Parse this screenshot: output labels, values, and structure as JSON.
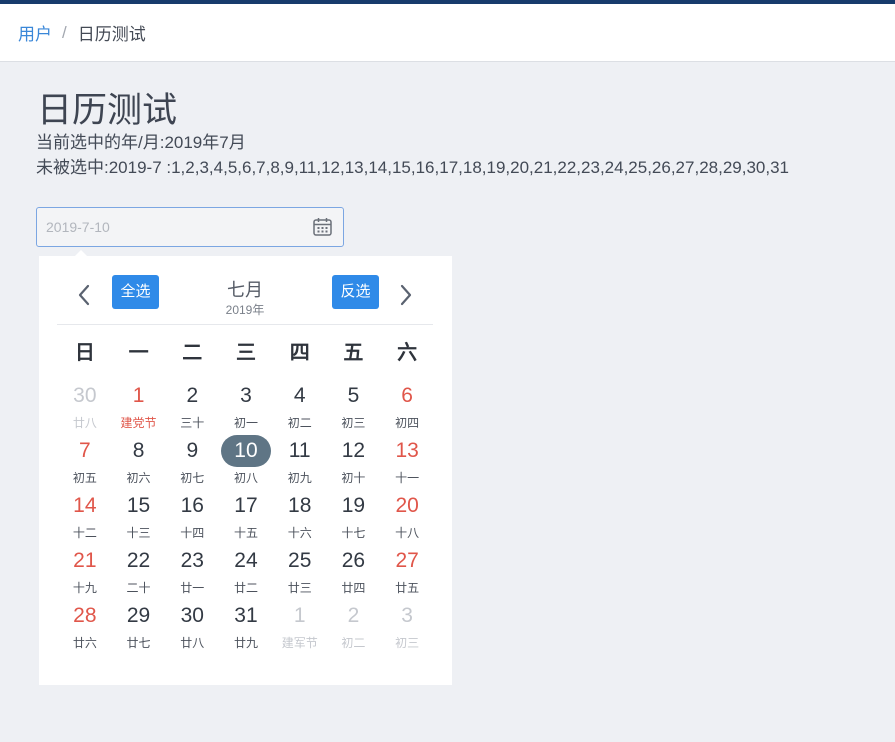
{
  "colors": {
    "top_bar": "#173b6c",
    "page_bg": "#eef0f4",
    "link": "#3a87d8",
    "accent": "#2f8ae8",
    "holiday_red": "#e0564a",
    "muted": "#c5c8ce",
    "selected_bg": "#5f7585"
  },
  "breadcrumb": {
    "root": "用户",
    "separator": "/",
    "current": "日历测试"
  },
  "page": {
    "title": "日历测试",
    "current_month_text": "当前选中的年/月:2019年7月",
    "unselected_text": "未被选中:2019-7 :1,2,3,4,5,6,7,8,9,11,12,13,14,15,16,17,18,19,20,21,22,23,24,25,26,27,28,29,30,31"
  },
  "date_input": {
    "value": "2019-7-10",
    "icon": "calendar-icon"
  },
  "calendar": {
    "prev_icon": "chevron-left-icon",
    "next_icon": "chevron-right-icon",
    "select_all_label": "全选",
    "invert_label": "反选",
    "month": "七月",
    "year": "2019年",
    "weekdays": [
      "日",
      "一",
      "二",
      "三",
      "四",
      "五",
      "六"
    ],
    "weeks": [
      [
        {
          "day": "30",
          "lunar": "廿八",
          "type": "prev-month"
        },
        {
          "day": "1",
          "lunar": "建党节",
          "type": "holiday"
        },
        {
          "day": "2",
          "lunar": "三十",
          "type": "normal"
        },
        {
          "day": "3",
          "lunar": "初一",
          "type": "normal"
        },
        {
          "day": "4",
          "lunar": "初二",
          "type": "normal"
        },
        {
          "day": "5",
          "lunar": "初三",
          "type": "normal"
        },
        {
          "day": "6",
          "lunar": "初四",
          "type": "weekend"
        }
      ],
      [
        {
          "day": "7",
          "lunar": "初五",
          "type": "weekend"
        },
        {
          "day": "8",
          "lunar": "初六",
          "type": "normal"
        },
        {
          "day": "9",
          "lunar": "初七",
          "type": "normal"
        },
        {
          "day": "10",
          "lunar": "初八",
          "type": "selected"
        },
        {
          "day": "11",
          "lunar": "初九",
          "type": "normal"
        },
        {
          "day": "12",
          "lunar": "初十",
          "type": "normal"
        },
        {
          "day": "13",
          "lunar": "十一",
          "type": "weekend"
        }
      ],
      [
        {
          "day": "14",
          "lunar": "十二",
          "type": "weekend"
        },
        {
          "day": "15",
          "lunar": "十三",
          "type": "normal"
        },
        {
          "day": "16",
          "lunar": "十四",
          "type": "normal"
        },
        {
          "day": "17",
          "lunar": "十五",
          "type": "normal"
        },
        {
          "day": "18",
          "lunar": "十六",
          "type": "normal"
        },
        {
          "day": "19",
          "lunar": "十七",
          "type": "normal"
        },
        {
          "day": "20",
          "lunar": "十八",
          "type": "weekend"
        }
      ],
      [
        {
          "day": "21",
          "lunar": "十九",
          "type": "weekend"
        },
        {
          "day": "22",
          "lunar": "二十",
          "type": "normal"
        },
        {
          "day": "23",
          "lunar": "廿一",
          "type": "normal"
        },
        {
          "day": "24",
          "lunar": "廿二",
          "type": "normal"
        },
        {
          "day": "25",
          "lunar": "廿三",
          "type": "normal"
        },
        {
          "day": "26",
          "lunar": "廿四",
          "type": "normal"
        },
        {
          "day": "27",
          "lunar": "廿五",
          "type": "weekend"
        }
      ],
      [
        {
          "day": "28",
          "lunar": "廿六",
          "type": "weekend"
        },
        {
          "day": "29",
          "lunar": "廿七",
          "type": "normal"
        },
        {
          "day": "30",
          "lunar": "廿八",
          "type": "normal"
        },
        {
          "day": "31",
          "lunar": "廿九",
          "type": "normal"
        },
        {
          "day": "1",
          "lunar": "建军节",
          "type": "next-month"
        },
        {
          "day": "2",
          "lunar": "初二",
          "type": "next-month"
        },
        {
          "day": "3",
          "lunar": "初三",
          "type": "next-month"
        }
      ]
    ]
  }
}
